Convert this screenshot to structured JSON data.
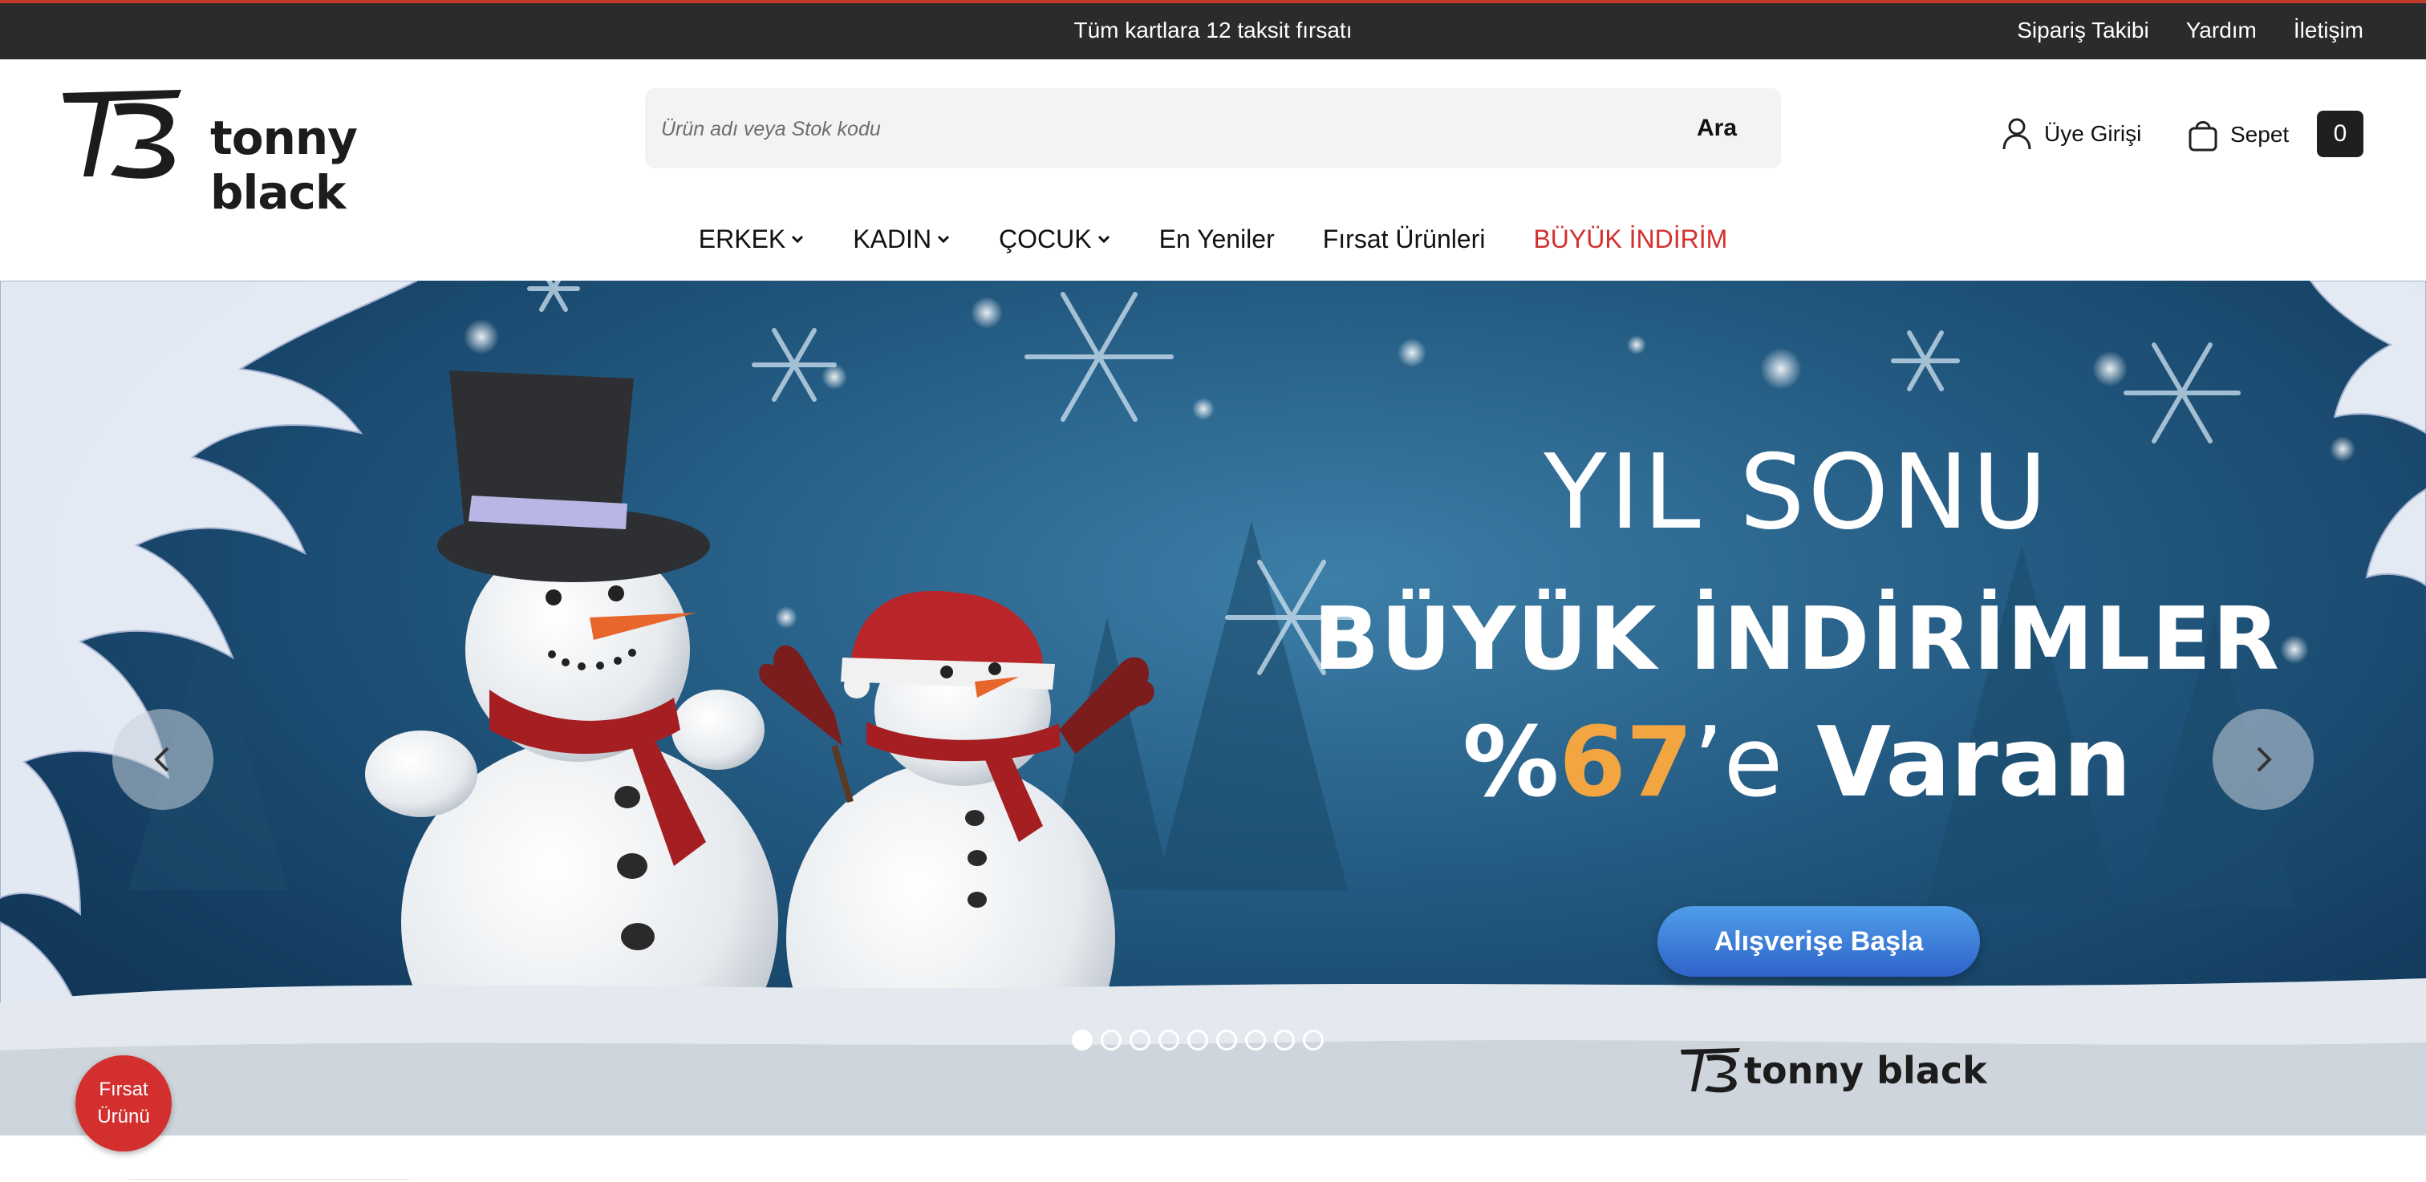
{
  "topbar": {
    "promo": "Tüm kartlara 12 taksit fırsatı",
    "links": [
      "Sipariş Takibi",
      "Yardım",
      "İletişim"
    ]
  },
  "brand": {
    "name": "tonny black"
  },
  "search": {
    "placeholder": "Ürün adı veya Stok kodu",
    "button": "Ara"
  },
  "account": {
    "login": "Üye Girişi",
    "cart": "Sepet",
    "cart_count": "0"
  },
  "nav": {
    "items": [
      {
        "label": "ERKEK",
        "dropdown": true
      },
      {
        "label": "KADIN",
        "dropdown": true
      },
      {
        "label": "ÇOCUK",
        "dropdown": true
      },
      {
        "label": "En Yeniler",
        "dropdown": false
      },
      {
        "label": "Fırsat Ürünleri",
        "dropdown": false
      },
      {
        "label": "BÜYÜK İNDİRİM",
        "dropdown": false,
        "color": "#d32f2f"
      }
    ]
  },
  "hero": {
    "line1": "YIL SONU",
    "line2": "BÜYÜK İNDİRİMLER",
    "line3_prefix": "%",
    "line3_number": "67",
    "line3_suffix": "’e",
    "line3_word": "Varan",
    "cta": "Alışverişe Başla",
    "logo_text": "tonny black",
    "slide_count": 9,
    "active_slide": 1
  },
  "badge": {
    "line1": "Fırsat",
    "line2": "Ürünü"
  },
  "colors": {
    "accent": "#d32f2f",
    "number": "#f2a540",
    "cta": "#3b7ddd",
    "topbar": "#2b2b2b"
  }
}
